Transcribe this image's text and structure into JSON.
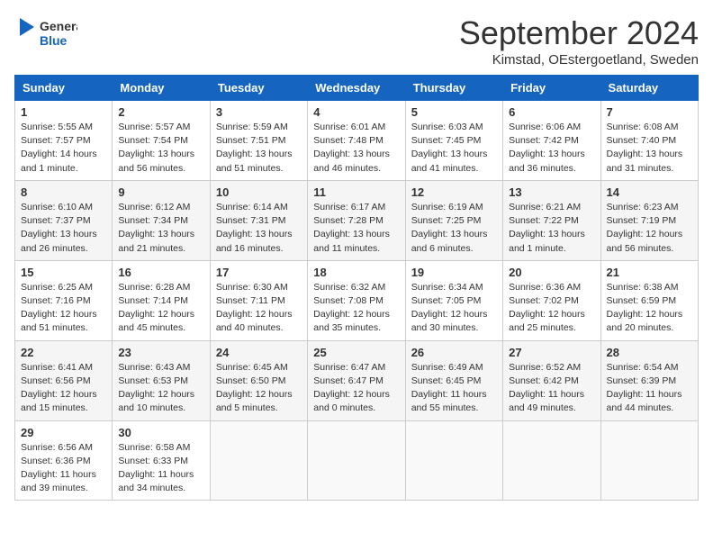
{
  "header": {
    "logo_general": "General",
    "logo_blue": "Blue",
    "month_title": "September 2024",
    "location": "Kimstad, OEstergoetland, Sweden"
  },
  "days_of_week": [
    "Sunday",
    "Monday",
    "Tuesday",
    "Wednesday",
    "Thursday",
    "Friday",
    "Saturday"
  ],
  "weeks": [
    [
      {
        "day": "1",
        "info": "Sunrise: 5:55 AM\nSunset: 7:57 PM\nDaylight: 14 hours\nand 1 minute."
      },
      {
        "day": "2",
        "info": "Sunrise: 5:57 AM\nSunset: 7:54 PM\nDaylight: 13 hours\nand 56 minutes."
      },
      {
        "day": "3",
        "info": "Sunrise: 5:59 AM\nSunset: 7:51 PM\nDaylight: 13 hours\nand 51 minutes."
      },
      {
        "day": "4",
        "info": "Sunrise: 6:01 AM\nSunset: 7:48 PM\nDaylight: 13 hours\nand 46 minutes."
      },
      {
        "day": "5",
        "info": "Sunrise: 6:03 AM\nSunset: 7:45 PM\nDaylight: 13 hours\nand 41 minutes."
      },
      {
        "day": "6",
        "info": "Sunrise: 6:06 AM\nSunset: 7:42 PM\nDaylight: 13 hours\nand 36 minutes."
      },
      {
        "day": "7",
        "info": "Sunrise: 6:08 AM\nSunset: 7:40 PM\nDaylight: 13 hours\nand 31 minutes."
      }
    ],
    [
      {
        "day": "8",
        "info": "Sunrise: 6:10 AM\nSunset: 7:37 PM\nDaylight: 13 hours\nand 26 minutes."
      },
      {
        "day": "9",
        "info": "Sunrise: 6:12 AM\nSunset: 7:34 PM\nDaylight: 13 hours\nand 21 minutes."
      },
      {
        "day": "10",
        "info": "Sunrise: 6:14 AM\nSunset: 7:31 PM\nDaylight: 13 hours\nand 16 minutes."
      },
      {
        "day": "11",
        "info": "Sunrise: 6:17 AM\nSunset: 7:28 PM\nDaylight: 13 hours\nand 11 minutes."
      },
      {
        "day": "12",
        "info": "Sunrise: 6:19 AM\nSunset: 7:25 PM\nDaylight: 13 hours\nand 6 minutes."
      },
      {
        "day": "13",
        "info": "Sunrise: 6:21 AM\nSunset: 7:22 PM\nDaylight: 13 hours\nand 1 minute."
      },
      {
        "day": "14",
        "info": "Sunrise: 6:23 AM\nSunset: 7:19 PM\nDaylight: 12 hours\nand 56 minutes."
      }
    ],
    [
      {
        "day": "15",
        "info": "Sunrise: 6:25 AM\nSunset: 7:16 PM\nDaylight: 12 hours\nand 51 minutes."
      },
      {
        "day": "16",
        "info": "Sunrise: 6:28 AM\nSunset: 7:14 PM\nDaylight: 12 hours\nand 45 minutes."
      },
      {
        "day": "17",
        "info": "Sunrise: 6:30 AM\nSunset: 7:11 PM\nDaylight: 12 hours\nand 40 minutes."
      },
      {
        "day": "18",
        "info": "Sunrise: 6:32 AM\nSunset: 7:08 PM\nDaylight: 12 hours\nand 35 minutes."
      },
      {
        "day": "19",
        "info": "Sunrise: 6:34 AM\nSunset: 7:05 PM\nDaylight: 12 hours\nand 30 minutes."
      },
      {
        "day": "20",
        "info": "Sunrise: 6:36 AM\nSunset: 7:02 PM\nDaylight: 12 hours\nand 25 minutes."
      },
      {
        "day": "21",
        "info": "Sunrise: 6:38 AM\nSunset: 6:59 PM\nDaylight: 12 hours\nand 20 minutes."
      }
    ],
    [
      {
        "day": "22",
        "info": "Sunrise: 6:41 AM\nSunset: 6:56 PM\nDaylight: 12 hours\nand 15 minutes."
      },
      {
        "day": "23",
        "info": "Sunrise: 6:43 AM\nSunset: 6:53 PM\nDaylight: 12 hours\nand 10 minutes."
      },
      {
        "day": "24",
        "info": "Sunrise: 6:45 AM\nSunset: 6:50 PM\nDaylight: 12 hours\nand 5 minutes."
      },
      {
        "day": "25",
        "info": "Sunrise: 6:47 AM\nSunset: 6:47 PM\nDaylight: 12 hours\nand 0 minutes."
      },
      {
        "day": "26",
        "info": "Sunrise: 6:49 AM\nSunset: 6:45 PM\nDaylight: 11 hours\nand 55 minutes."
      },
      {
        "day": "27",
        "info": "Sunrise: 6:52 AM\nSunset: 6:42 PM\nDaylight: 11 hours\nand 49 minutes."
      },
      {
        "day": "28",
        "info": "Sunrise: 6:54 AM\nSunset: 6:39 PM\nDaylight: 11 hours\nand 44 minutes."
      }
    ],
    [
      {
        "day": "29",
        "info": "Sunrise: 6:56 AM\nSunset: 6:36 PM\nDaylight: 11 hours\nand 39 minutes."
      },
      {
        "day": "30",
        "info": "Sunrise: 6:58 AM\nSunset: 6:33 PM\nDaylight: 11 hours\nand 34 minutes."
      },
      {
        "day": "",
        "info": ""
      },
      {
        "day": "",
        "info": ""
      },
      {
        "day": "",
        "info": ""
      },
      {
        "day": "",
        "info": ""
      },
      {
        "day": "",
        "info": ""
      }
    ]
  ]
}
